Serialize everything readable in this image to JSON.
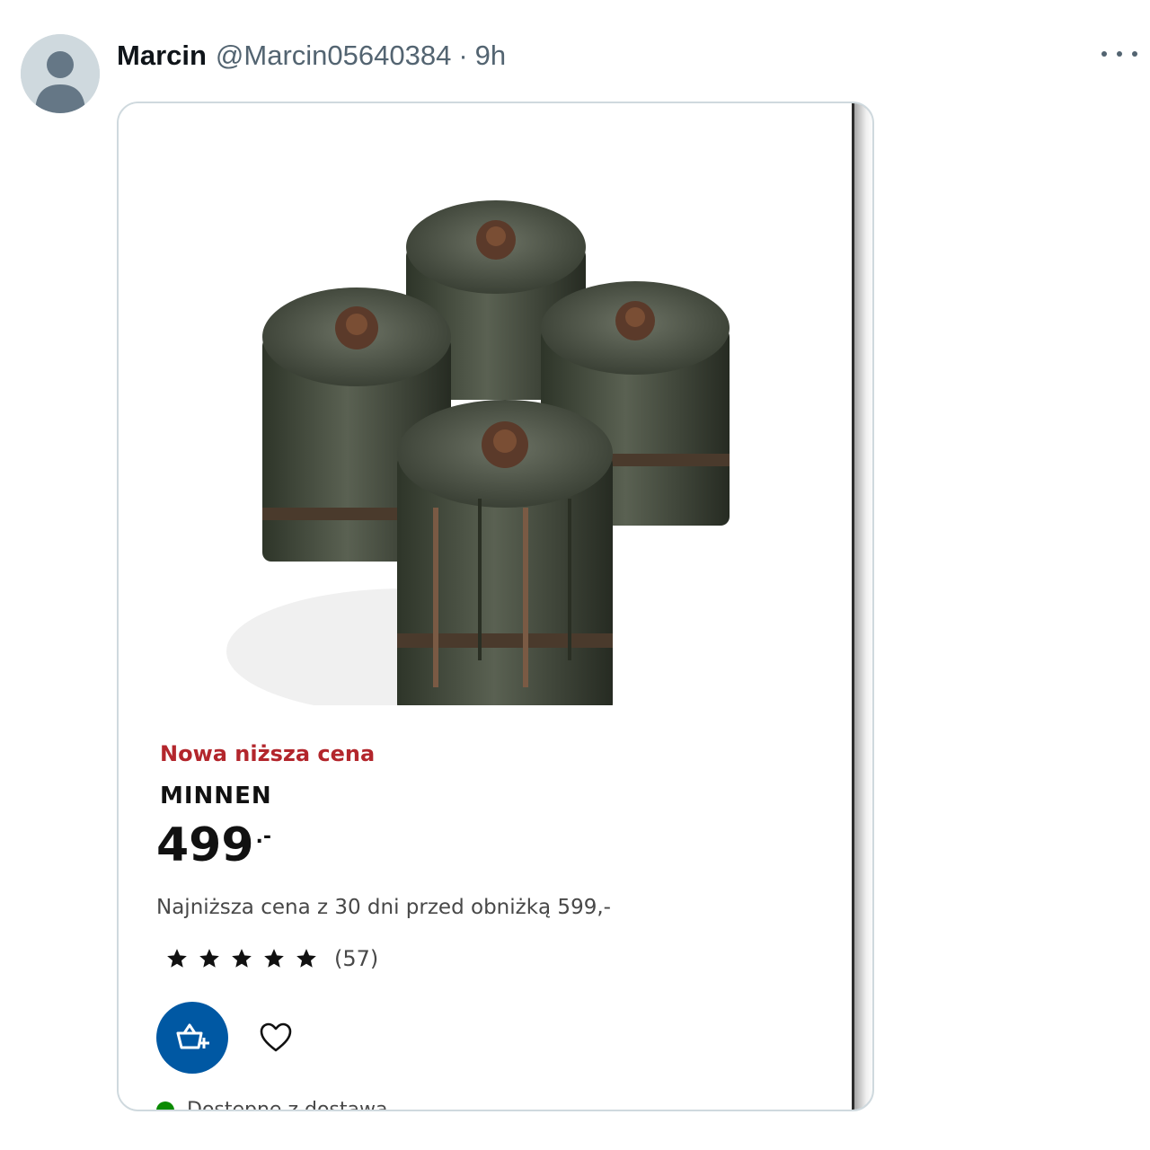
{
  "tweet": {
    "author_name": "Marcin",
    "author_handle": "@Marcin05640384",
    "separator": "·",
    "time": "9h"
  },
  "icons": {
    "avatar": "default-avatar-icon",
    "more": "more-options-icon",
    "cart": "add-to-cart-icon",
    "favorite": "heart-icon",
    "star": "star-icon",
    "availability": "status-dot-icon"
  },
  "product": {
    "badge": "Nowa niższa cena",
    "name": "MINNEN",
    "price": "499",
    "price_suffix": ".-",
    "lowest_price_note": "Najniższa cena z 30 dni przed obniżką 599,-",
    "rating": 5,
    "rating_max": 5,
    "review_count": "(57)",
    "availability": "Dostępne z dostawą"
  },
  "colors": {
    "badge": "#b3262c",
    "cart_button": "#0058a3",
    "availability_dot": "#0a8a00"
  }
}
